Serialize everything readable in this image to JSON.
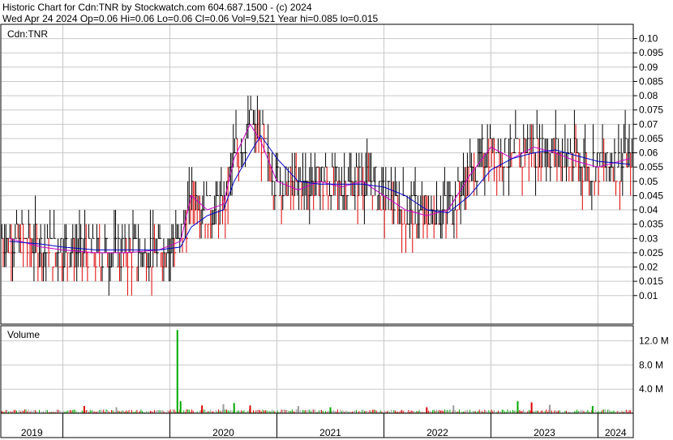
{
  "header": {
    "line1": "Historic Chart for Cdn:TNR by Stockwatch.com 604.687.1500 - (c) 2024",
    "line2": "Wed Apr 24 2024  Op=0.06  Hi=0.06  Lo=0.06  Cl=0.06  Vol=9,521  Year hi=0.085  lo=0.015"
  },
  "colors": {
    "up": "#000000",
    "down": "#dd0000",
    "ma_short": "#cc00cc",
    "ma_long": "#0000cc",
    "vol_up": "#00aa00",
    "vol_down": "#dd0000",
    "vol_flat": "#999999",
    "grid": "#c8c8c8"
  },
  "chart_data": [
    {
      "type": "line",
      "panel_label": "Cdn:TNR",
      "ylim": [
        0.0,
        0.105
      ],
      "y_ticks": [
        "0.10",
        "0.095",
        "0.09",
        "0.085",
        "0.08",
        "0.075",
        "0.07",
        "0.065",
        "0.06",
        "0.055",
        "0.05",
        "0.045",
        "0.04",
        "0.035",
        "0.03",
        "0.025",
        "0.02",
        "0.015",
        "0.01"
      ],
      "x_ticks": [
        "2019",
        "2020",
        "2021",
        "2022",
        "2023",
        "2024"
      ],
      "series": [
        {
          "x": [
            2018.5,
            2018.8,
            2019.0,
            2019.3,
            2019.6,
            2019.9,
            2020.1,
            2020.2,
            2020.35,
            2020.5,
            2020.6,
            2020.75,
            2020.85,
            2021.0,
            2021.2,
            2021.4,
            2021.6,
            2021.8,
            2022.0,
            2022.2,
            2022.4,
            2022.6,
            2022.8,
            2023.0,
            2023.2,
            2023.4,
            2023.6,
            2023.8,
            2024.0,
            2024.3
          ],
          "values": [
            0.03,
            0.027,
            0.026,
            0.025,
            0.025,
            0.026,
            0.029,
            0.045,
            0.04,
            0.042,
            0.058,
            0.07,
            0.064,
            0.05,
            0.047,
            0.05,
            0.048,
            0.05,
            0.045,
            0.04,
            0.038,
            0.04,
            0.052,
            0.062,
            0.058,
            0.062,
            0.06,
            0.057,
            0.055,
            0.058
          ]
        },
        {
          "x": [
            2018.5,
            2018.8,
            2019.0,
            2019.3,
            2019.6,
            2019.9,
            2020.1,
            2020.2,
            2020.35,
            2020.5,
            2020.6,
            2020.75,
            2020.85,
            2021.0,
            2021.2,
            2021.4,
            2021.6,
            2021.8,
            2022.0,
            2022.2,
            2022.4,
            2022.6,
            2022.8,
            2023.0,
            2023.2,
            2023.4,
            2023.6,
            2023.8,
            2024.0,
            2024.3
          ],
          "values": [
            0.029,
            0.028,
            0.027,
            0.026,
            0.026,
            0.026,
            0.027,
            0.034,
            0.038,
            0.04,
            0.05,
            0.06,
            0.066,
            0.058,
            0.05,
            0.049,
            0.049,
            0.049,
            0.048,
            0.045,
            0.04,
            0.039,
            0.045,
            0.054,
            0.058,
            0.06,
            0.061,
            0.059,
            0.057,
            0.056
          ]
        }
      ]
    },
    {
      "type": "bar",
      "panel_label": "Volume",
      "ylim": [
        0,
        14.5
      ],
      "y_ticks": [
        "12.0 M",
        "8.0 M",
        "4.0 M"
      ],
      "x": [
        2020.07,
        2019.2,
        2019.5,
        2020.1,
        2020.3,
        2020.5,
        2020.6,
        2020.75,
        2021.2,
        2021.5,
        2022.4,
        2022.65,
        2023.25,
        2023.38,
        2023.55,
        2023.95
      ],
      "values": [
        13.8,
        1.2,
        1.0,
        2.0,
        1.3,
        1.5,
        1.7,
        1.3,
        1.2,
        1.0,
        1.0,
        1.3,
        2.0,
        1.8,
        1.4,
        1.2
      ]
    }
  ]
}
